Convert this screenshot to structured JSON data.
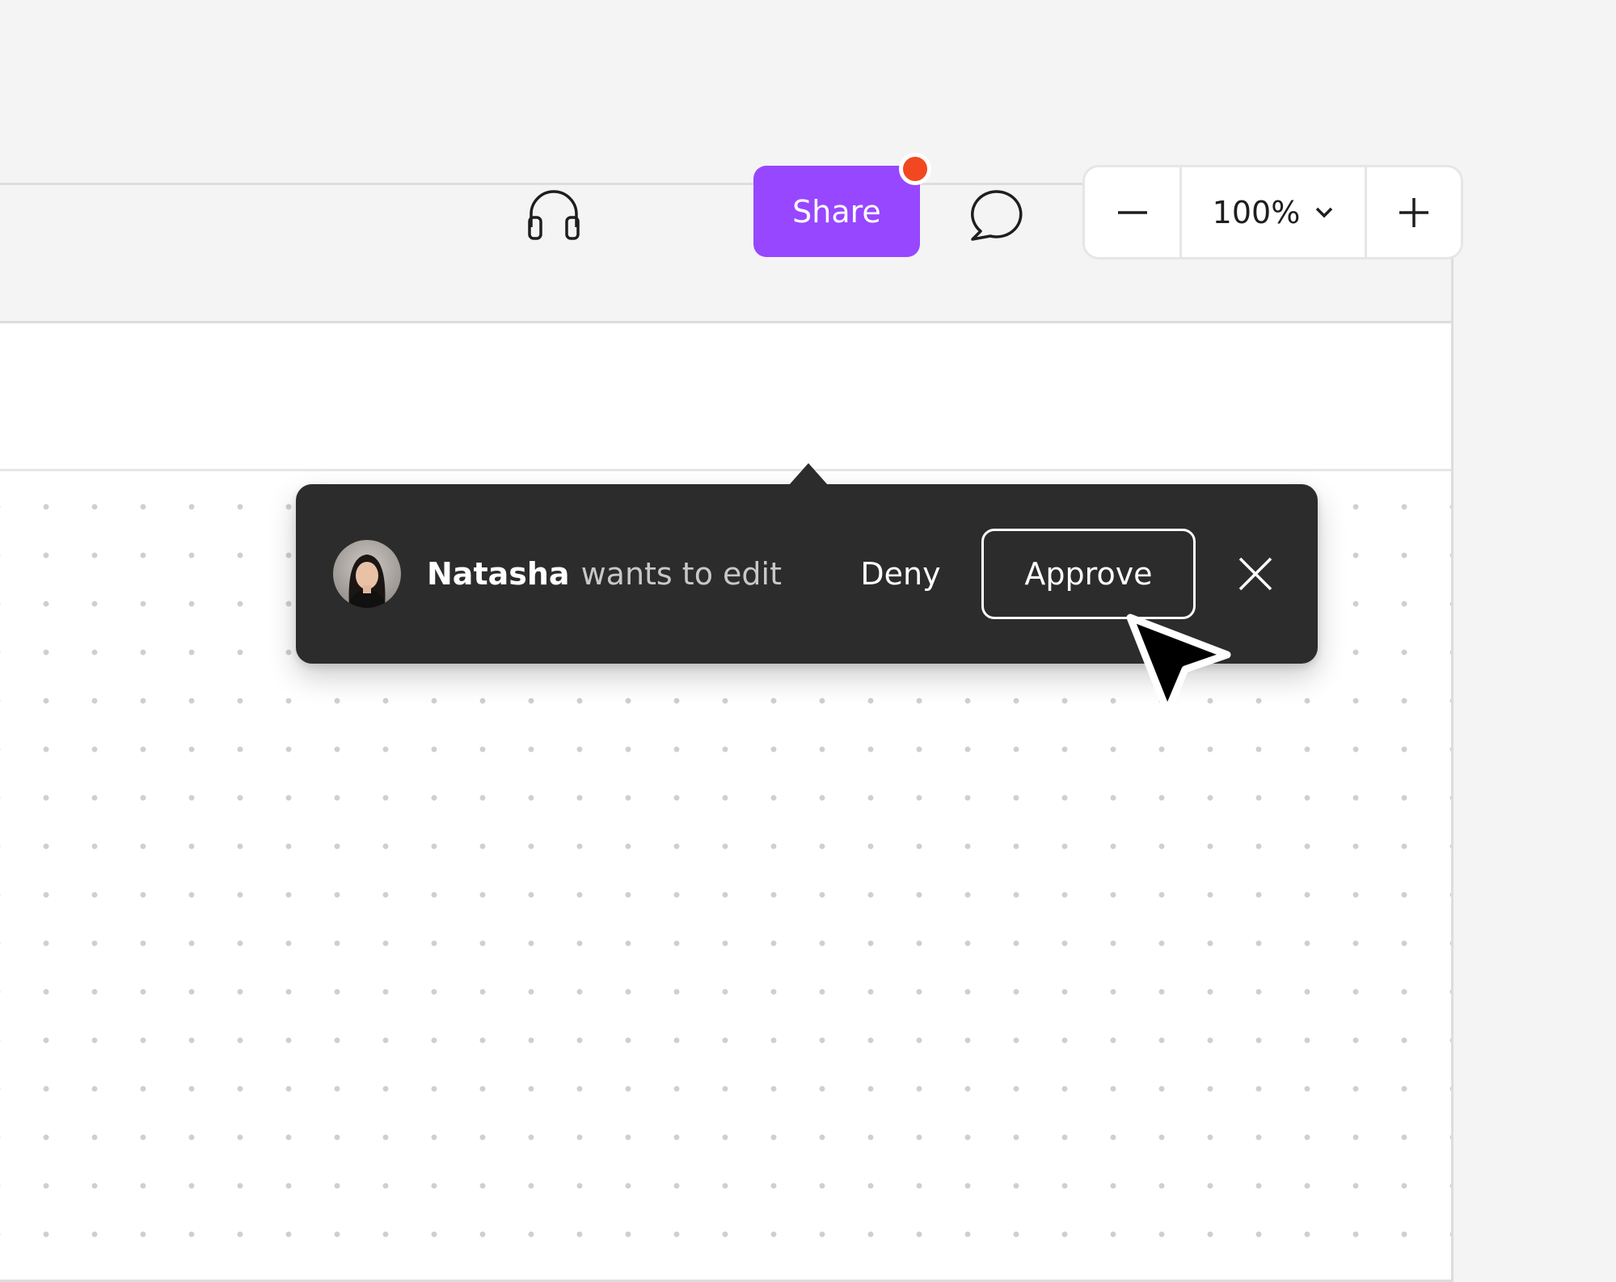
{
  "toolbar": {
    "share_label": "Share",
    "zoom_level": "100%"
  },
  "request_popover": {
    "user_name": "Natasha",
    "message": "wants to edit",
    "deny_label": "Deny",
    "approve_label": "Approve"
  },
  "colors": {
    "share_accent": "#9747ff",
    "notification_dot": "#f24822",
    "popover_background": "#2c2c2c"
  },
  "icons": [
    "headphones-icon",
    "comment-icon",
    "zoom-out-icon",
    "chevron-down-icon",
    "zoom-in-icon",
    "close-icon",
    "mouse-cursor-icon"
  ]
}
